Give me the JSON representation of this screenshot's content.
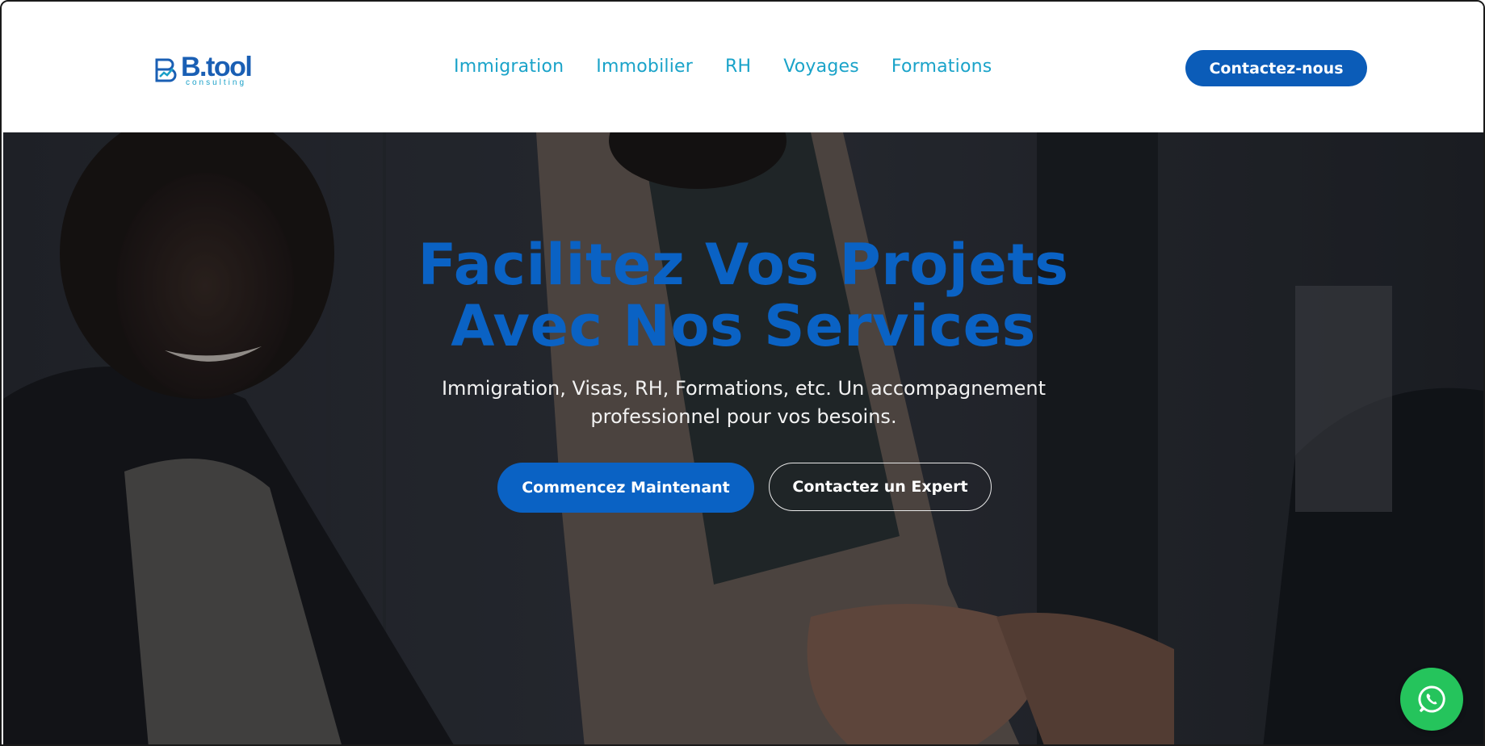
{
  "colors": {
    "brand_blue": "#0a62c4",
    "nav_teal": "#1aa3c9",
    "whatsapp_green": "#25c45c"
  },
  "logo": {
    "word": "B.tool",
    "sub": "consulting"
  },
  "nav": {
    "items": [
      {
        "label": "Immigration"
      },
      {
        "label": "Immobilier"
      },
      {
        "label": "RH"
      },
      {
        "label": "Voyages"
      },
      {
        "label": "Formations"
      }
    ],
    "cta_label": "Contactez-nous"
  },
  "hero": {
    "title_line1": "Facilitez Vos Projets",
    "title_line2": "Avec Nos Services",
    "subtitle": "Immigration, Visas, RH, Formations, etc. Un accompagnement professionnel pour vos besoins.",
    "primary_button": "Commencez Maintenant",
    "secondary_button": "Contactez un Expert",
    "background_image": "people-shaking-hands"
  },
  "floating": {
    "icon": "whatsapp-icon"
  }
}
